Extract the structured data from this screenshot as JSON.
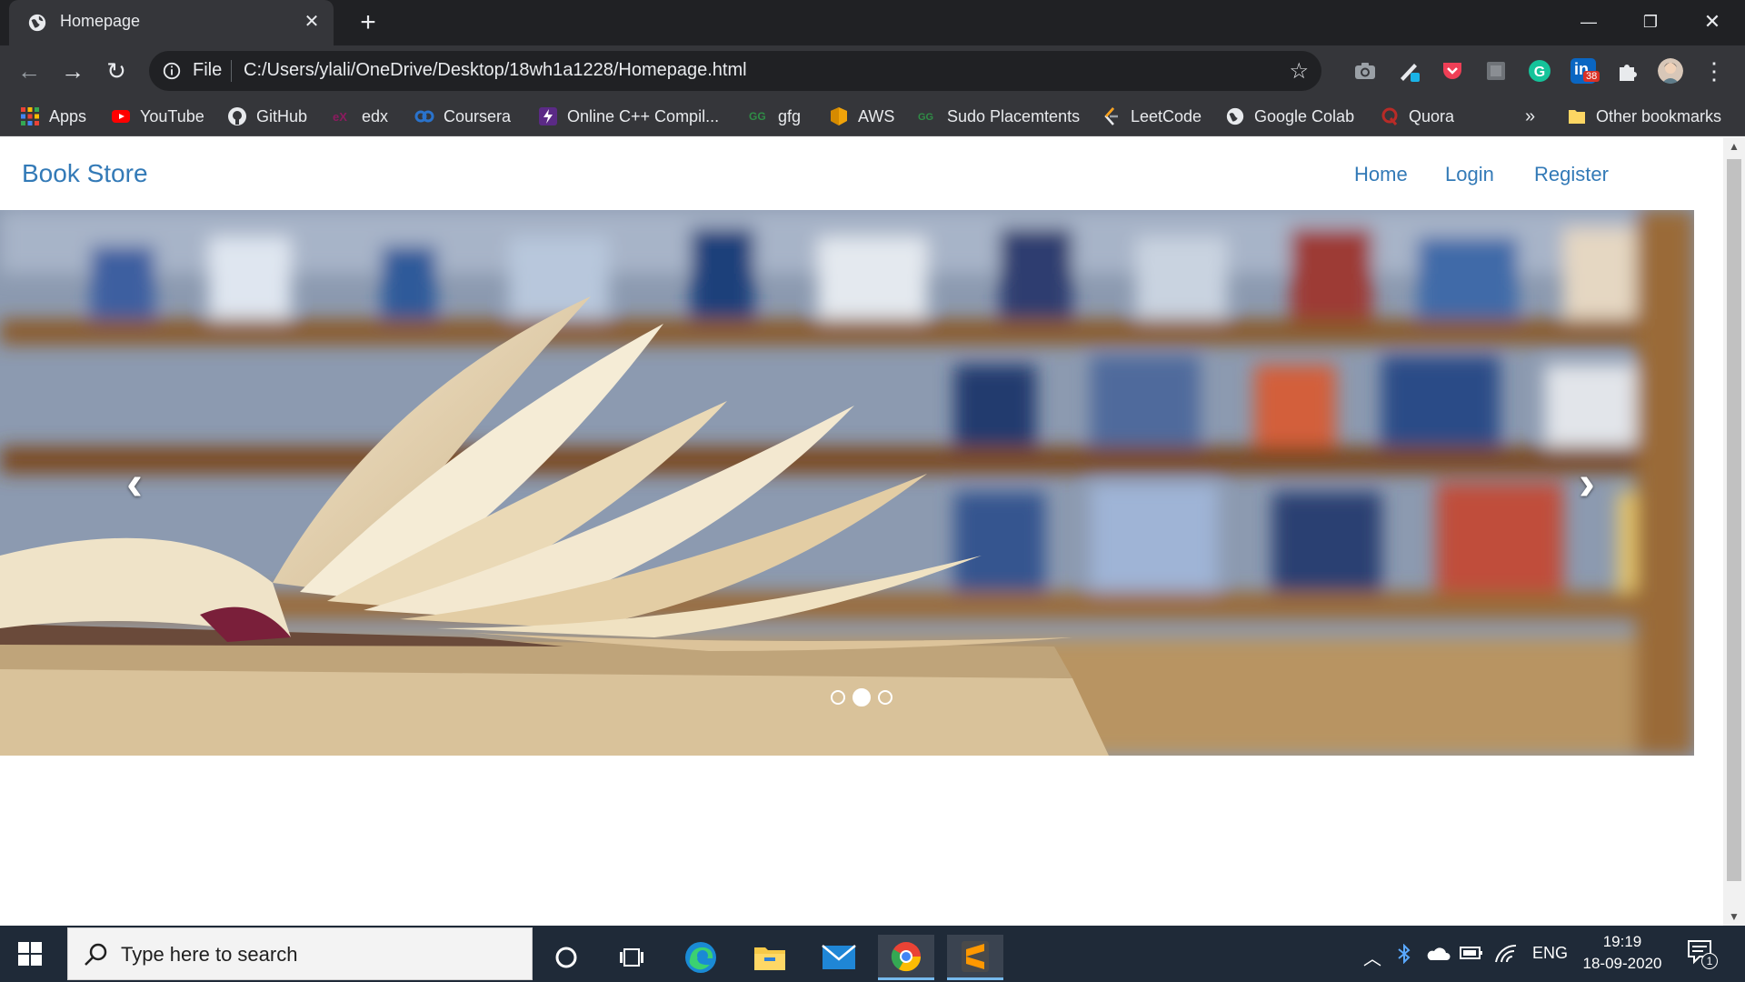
{
  "browser": {
    "tab_title": "Homepage",
    "new_tab": "+",
    "url_scheme": "File",
    "url": "C:/Users/ylali/OneDrive/Desktop/18wh1a1228/Homepage.html",
    "extension_badge": "38",
    "bookmarks": [
      {
        "label": "Apps",
        "icon": "apps-grid-icon"
      },
      {
        "label": "YouTube",
        "icon": "youtube-icon"
      },
      {
        "label": "GitHub",
        "icon": "github-icon"
      },
      {
        "label": "edx",
        "icon": "edx-icon"
      },
      {
        "label": "Coursera",
        "icon": "coursera-icon"
      },
      {
        "label": "Online C++ Compil...",
        "icon": "compiler-icon"
      },
      {
        "label": "gfg",
        "icon": "gfg-icon"
      },
      {
        "label": "AWS",
        "icon": "aws-icon"
      },
      {
        "label": "Sudo Placemtents",
        "icon": "sudo-icon"
      },
      {
        "label": "LeetCode",
        "icon": "leetcode-icon"
      },
      {
        "label": "Google Colab",
        "icon": "globe-icon"
      },
      {
        "label": "Quora",
        "icon": "quora-icon"
      }
    ],
    "bookmarks_overflow": "»",
    "other_bookmarks": "Other bookmarks"
  },
  "page": {
    "brand": "Book Store",
    "nav": [
      {
        "label": "Home"
      },
      {
        "label": "Login"
      },
      {
        "label": "Register"
      }
    ],
    "carousel": {
      "prev": "‹",
      "next": "›",
      "slide_count": 3,
      "active_slide": 2
    }
  },
  "taskbar": {
    "search_placeholder": "Type here to search",
    "language": "ENG",
    "time": "19:19",
    "date": "18-09-2020",
    "notification_count": "1"
  },
  "colors": {
    "link": "#337ab7",
    "chrome_dark": "#202124",
    "chrome_toolbar": "#35363a",
    "taskbar": "#1f2a38"
  }
}
